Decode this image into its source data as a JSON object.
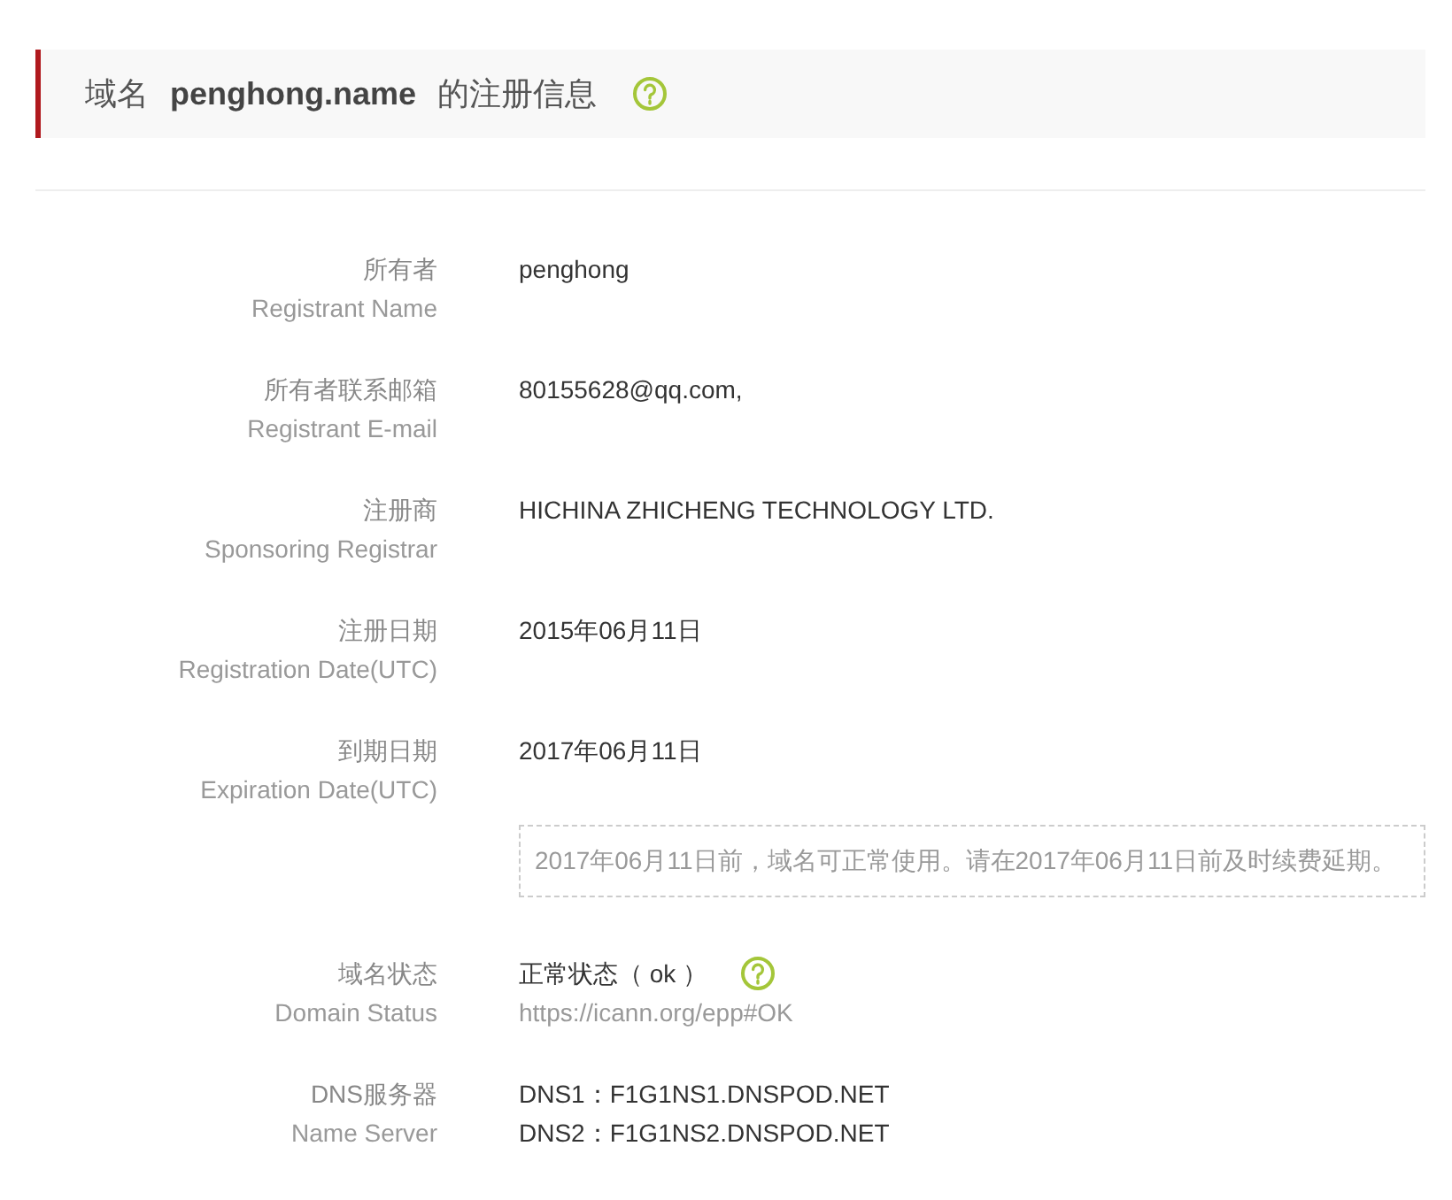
{
  "header": {
    "prefix": "域名",
    "domain": "penghong.name",
    "suffix": "的注册信息"
  },
  "rows": [
    {
      "kind": "plain",
      "label": "所有者",
      "label_en": "Registrant Name",
      "values": [
        "penghong"
      ]
    },
    {
      "kind": "plain",
      "label": "所有者联系邮箱",
      "label_en": "Registrant E-mail",
      "values": [
        "80155628@qq.com,"
      ]
    },
    {
      "kind": "plain",
      "label": "注册商",
      "label_en": "Sponsoring Registrar",
      "values": [
        "HICHINA ZHICHENG TECHNOLOGY LTD."
      ]
    },
    {
      "kind": "plain",
      "label": "注册日期",
      "label_en": "Registration Date(UTC)",
      "values": [
        "2015年06月11日"
      ]
    },
    {
      "kind": "notice",
      "label": "到期日期",
      "label_en": "Expiration Date(UTC)",
      "values": [
        "2017年06月11日"
      ],
      "notice": "2017年06月11日前，域名可正常使用。请在2017年06月11日前及时续费延期。"
    },
    {
      "kind": "status",
      "label": "域名状态",
      "label_en": "Domain Status",
      "values": [
        "正常状态（ ok ）"
      ],
      "link": "https://icann.org/epp#OK"
    },
    {
      "kind": "plain",
      "label": "DNS服务器",
      "label_en": "Name Server",
      "values": [
        "DNS1：F1G1NS1.DNSPOD.NET",
        "DNS2：F1G1NS2.DNSPOD.NET"
      ]
    }
  ]
}
